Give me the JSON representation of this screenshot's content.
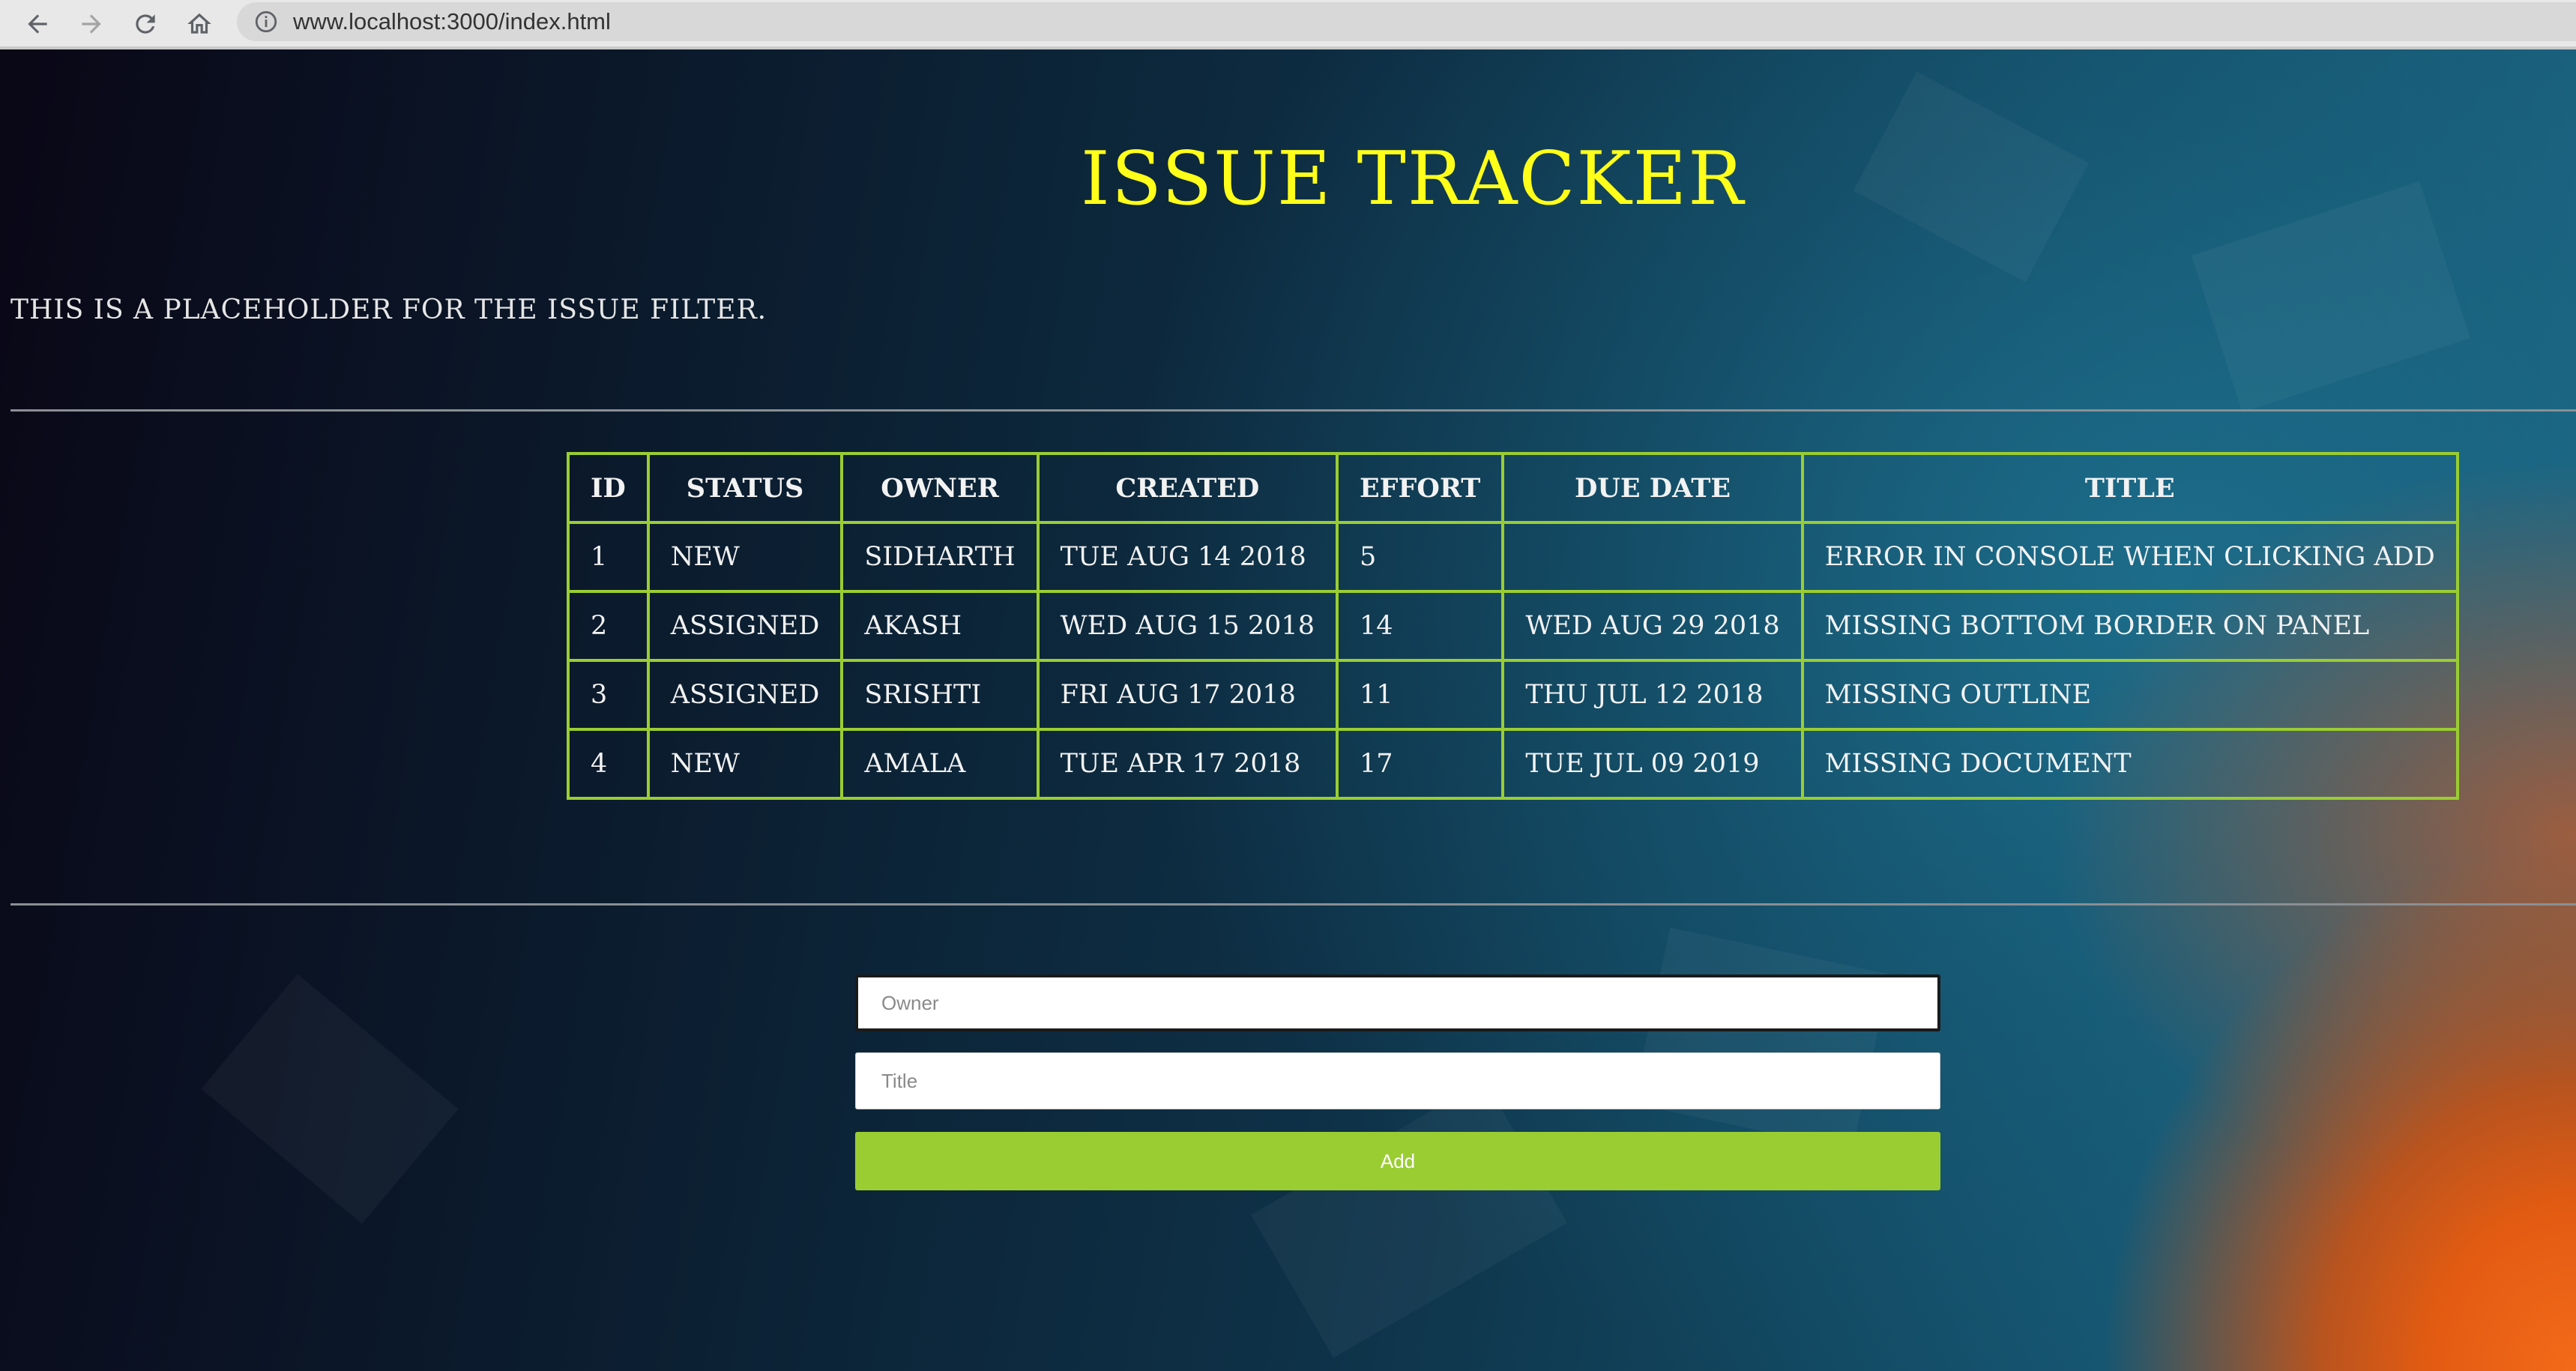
{
  "browser": {
    "url": "www.localhost:3000/index.html"
  },
  "page": {
    "title": "ISSUE TRACKER",
    "filter_placeholder": "THIS IS A PLACEHOLDER FOR THE ISSUE FILTER."
  },
  "issue_table": {
    "headers": [
      "ID",
      "STATUS",
      "OWNER",
      "CREATED",
      "EFFORT",
      "DUE DATE",
      "TITLE"
    ],
    "rows": [
      [
        "1",
        "NEW",
        "SIDHARTH",
        "TUE AUG 14 2018",
        "5",
        "",
        "ERROR IN CONSOLE WHEN CLICKING ADD"
      ],
      [
        "2",
        "ASSIGNED",
        "AKASH",
        "WED AUG 15 2018",
        "14",
        "WED AUG 29 2018",
        "MISSING BOTTOM BORDER ON PANEL"
      ],
      [
        "3",
        "ASSIGNED",
        "SRISHTI",
        "FRI AUG 17 2018",
        "11",
        "THU JUL 12 2018",
        "MISSING OUTLINE"
      ],
      [
        "4",
        "NEW",
        "AMALA",
        "TUE APR 17 2018",
        "17",
        "TUE JUL 09 2019",
        "MISSING DOCUMENT"
      ]
    ]
  },
  "add_form": {
    "owner_placeholder": "Owner",
    "title_placeholder": "Title",
    "add_label": "Add"
  },
  "colors": {
    "title": "#ffff1a",
    "table_border": "#9acd32",
    "button": "#9acd32"
  },
  "icons": {
    "back": "arrow-left-icon",
    "forward": "arrow-right-icon",
    "reload": "reload-icon",
    "home": "home-icon",
    "site_info": "info-icon"
  }
}
